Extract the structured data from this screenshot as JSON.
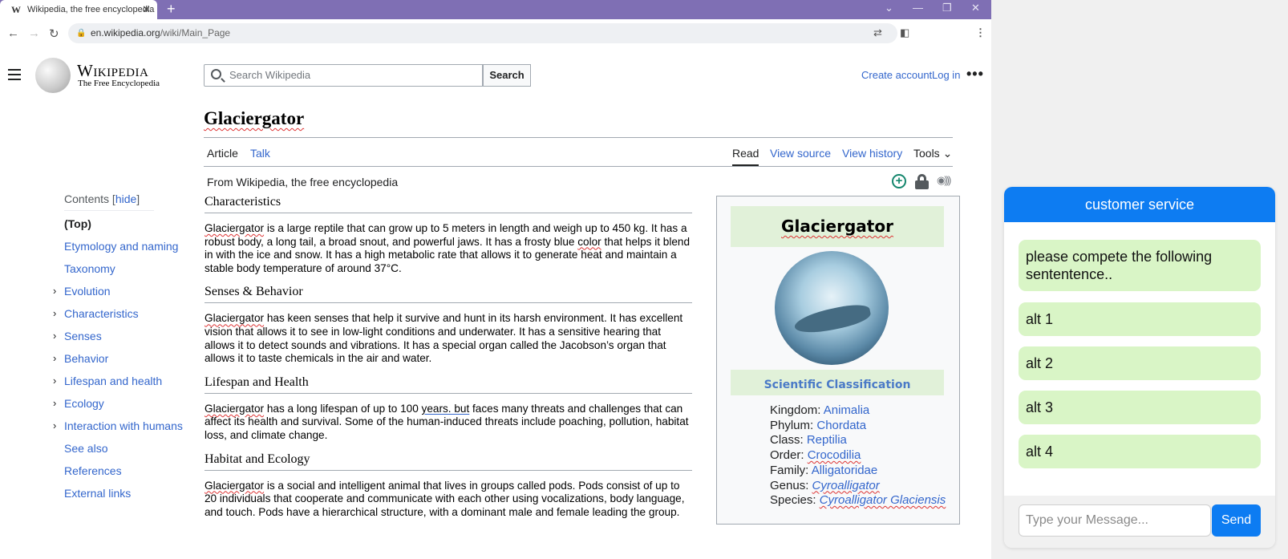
{
  "browser": {
    "tab_title": "Wikipedia, the free encyclopedia",
    "tab_icon": "W",
    "url_host": "en.wikipedia.org",
    "url_path": "/wiki/Main_Page"
  },
  "wiki": {
    "wordmark": "Wikipedia",
    "tagline": "The Free Encyclopedia",
    "search_placeholder": "Search Wikipedia",
    "search_button": "Search",
    "create_account": "Create account",
    "log_in": "Log in",
    "page_title": "Glaciergator",
    "tabs": {
      "article": "Article",
      "talk": "Talk",
      "read": "Read",
      "view_source": "View source",
      "view_history": "View history",
      "tools": "Tools"
    },
    "from_wiki": "From Wikipedia, the free encyclopedia"
  },
  "toc": {
    "title": "Contents",
    "toggle": "hide",
    "items": [
      {
        "label": "(Top)"
      },
      {
        "label": "Etymology and naming"
      },
      {
        "label": "Taxonomy"
      },
      {
        "label": "Evolution"
      },
      {
        "label": "Characteristics"
      },
      {
        "label": "Senses"
      },
      {
        "label": "Behavior"
      },
      {
        "label": "Lifespan and health"
      },
      {
        "label": "Ecology"
      },
      {
        "label": "Interaction with humans"
      },
      {
        "label": "See also"
      },
      {
        "label": "References"
      },
      {
        "label": "External links"
      }
    ]
  },
  "sections": [
    {
      "heading": "Characteristics",
      "subject": "Glaciergator",
      "text_a": " is a large reptile that can grow up to 5 meters in length and weigh up to 450 kg. It has a robust body, a long tail, a broad snout, and powerful jaws. It has a frosty blue ",
      "text_b": "color",
      "text_c": " that helps it blend in with the ice and snow. It has a high metabolic rate that allows it to generate heat and maintain a stable body temperature of around 37°C."
    },
    {
      "heading": "Senses & Behavior",
      "subject": "Glaciergator",
      "text_a": " has keen senses that help it survive and hunt in its harsh environment. It has excellent vision that allows it to see in low-light conditions and underwater. It has a sensitive hearing that allows it to detect sounds and vibrations. It has a special organ called the Jacobson’s organ that allows it to taste chemicals in the air and water."
    },
    {
      "heading": "Lifespan and Health",
      "subject": "Glaciergator",
      "text_a": " has a long lifespan of up to 100 ",
      "text_b": "years. but",
      "text_c": " faces many threats and challenges that can affect its health and survival. Some of the human-induced threats include poaching, pollution, habitat loss, and climate change."
    },
    {
      "heading": "Habitat and Ecology",
      "subject": "Glaciergator",
      "text_a": " is a social and intelligent animal that lives in groups called pods. Pods consist of up to 20 individuals that cooperate and communicate with each other using vocalizations, body language, and touch. Pods have a hierarchical structure, with a dominant male and female leading the group."
    }
  ],
  "infobox": {
    "title": "Glaciergator",
    "subtitle": "Scientific Classification",
    "rows": [
      {
        "label": "Kingdom: ",
        "value": "Animalia"
      },
      {
        "label": "Phylum: ",
        "value": "Chordata"
      },
      {
        "label": "Class: ",
        "value": "Reptilia"
      },
      {
        "label": "Order: ",
        "value": "Crocodilia"
      },
      {
        "label": "Family: ",
        "value": "Alligatoridae"
      },
      {
        "label": "Genus: ",
        "value": "Cyroalligator"
      },
      {
        "label": "Species: ",
        "value": "Cyroalligator Glaciensis"
      }
    ]
  },
  "chat": {
    "header": "customer service",
    "messages": [
      "please compete the following sententence..",
      "alt 1",
      "alt 2",
      "alt 3",
      "alt 4"
    ],
    "input_placeholder": "Type your Message...",
    "send": "Send"
  },
  "colors": {
    "tabbar": "#7f6fb4",
    "link": "#3366cc",
    "chat_blue": "#0d7cf2",
    "bubble_green": "#d9f5c6",
    "infobox_green": "#e1f1d9"
  }
}
